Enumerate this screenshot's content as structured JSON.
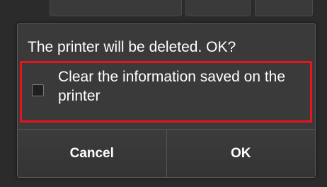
{
  "dialog": {
    "message": "The printer will be deleted. OK?",
    "option": {
      "label": "Clear the information saved on the printer",
      "checked": false
    },
    "buttons": {
      "cancel_label": "Cancel",
      "ok_label": "OK"
    }
  },
  "colors": {
    "highlight_border": "#e8141b",
    "dialog_background": "#3a3a3a",
    "text": "#ffffff"
  }
}
